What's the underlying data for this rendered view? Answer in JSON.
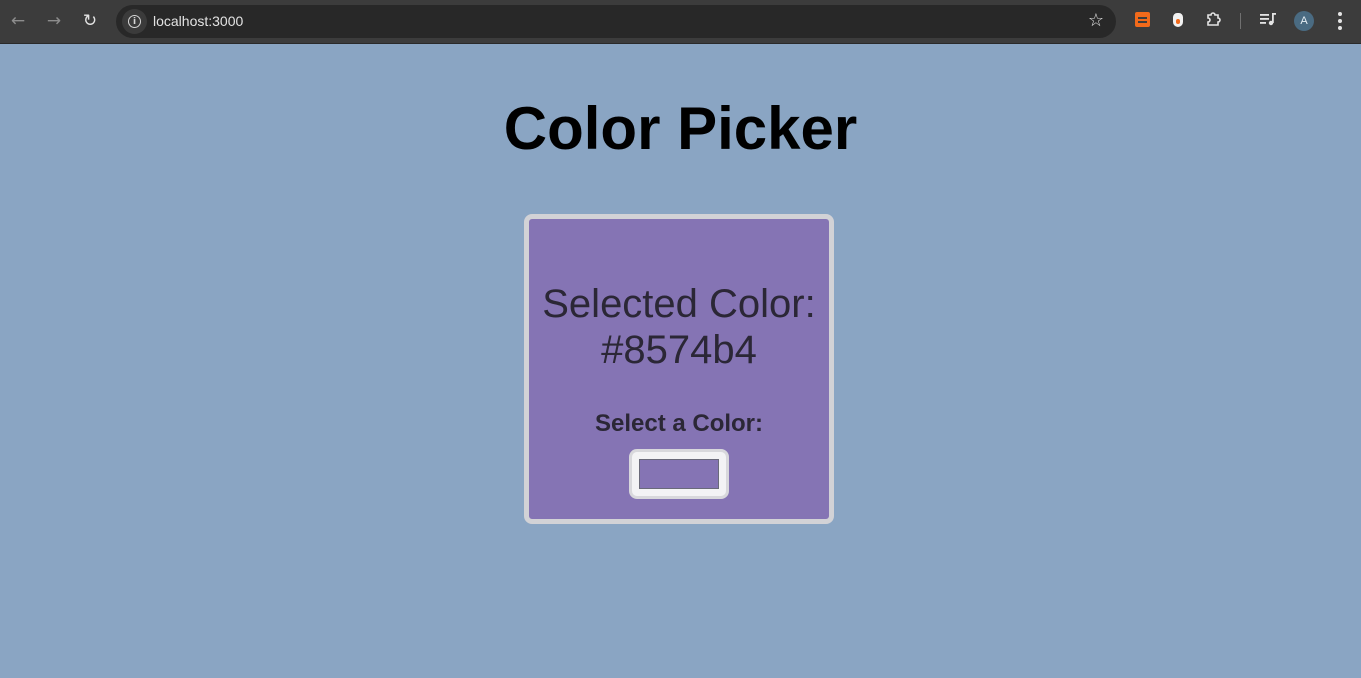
{
  "browser": {
    "url": "localhost:3000",
    "avatar_letter": "A",
    "icons": [
      "back-arrow-icon",
      "forward-arrow-icon",
      "reload-icon",
      "site-info-icon",
      "bookmark-star-icon",
      "extension-icon",
      "puzzle-icon",
      "media-controls-icon",
      "kebab-menu-icon"
    ]
  },
  "page": {
    "background_color": "#8aa5c3",
    "title": "Color Picker"
  },
  "card": {
    "selected_label": "Selected Color:",
    "selected_value": "#8574b4",
    "select_label": "Select a Color:",
    "current_color": "#8574b4"
  }
}
